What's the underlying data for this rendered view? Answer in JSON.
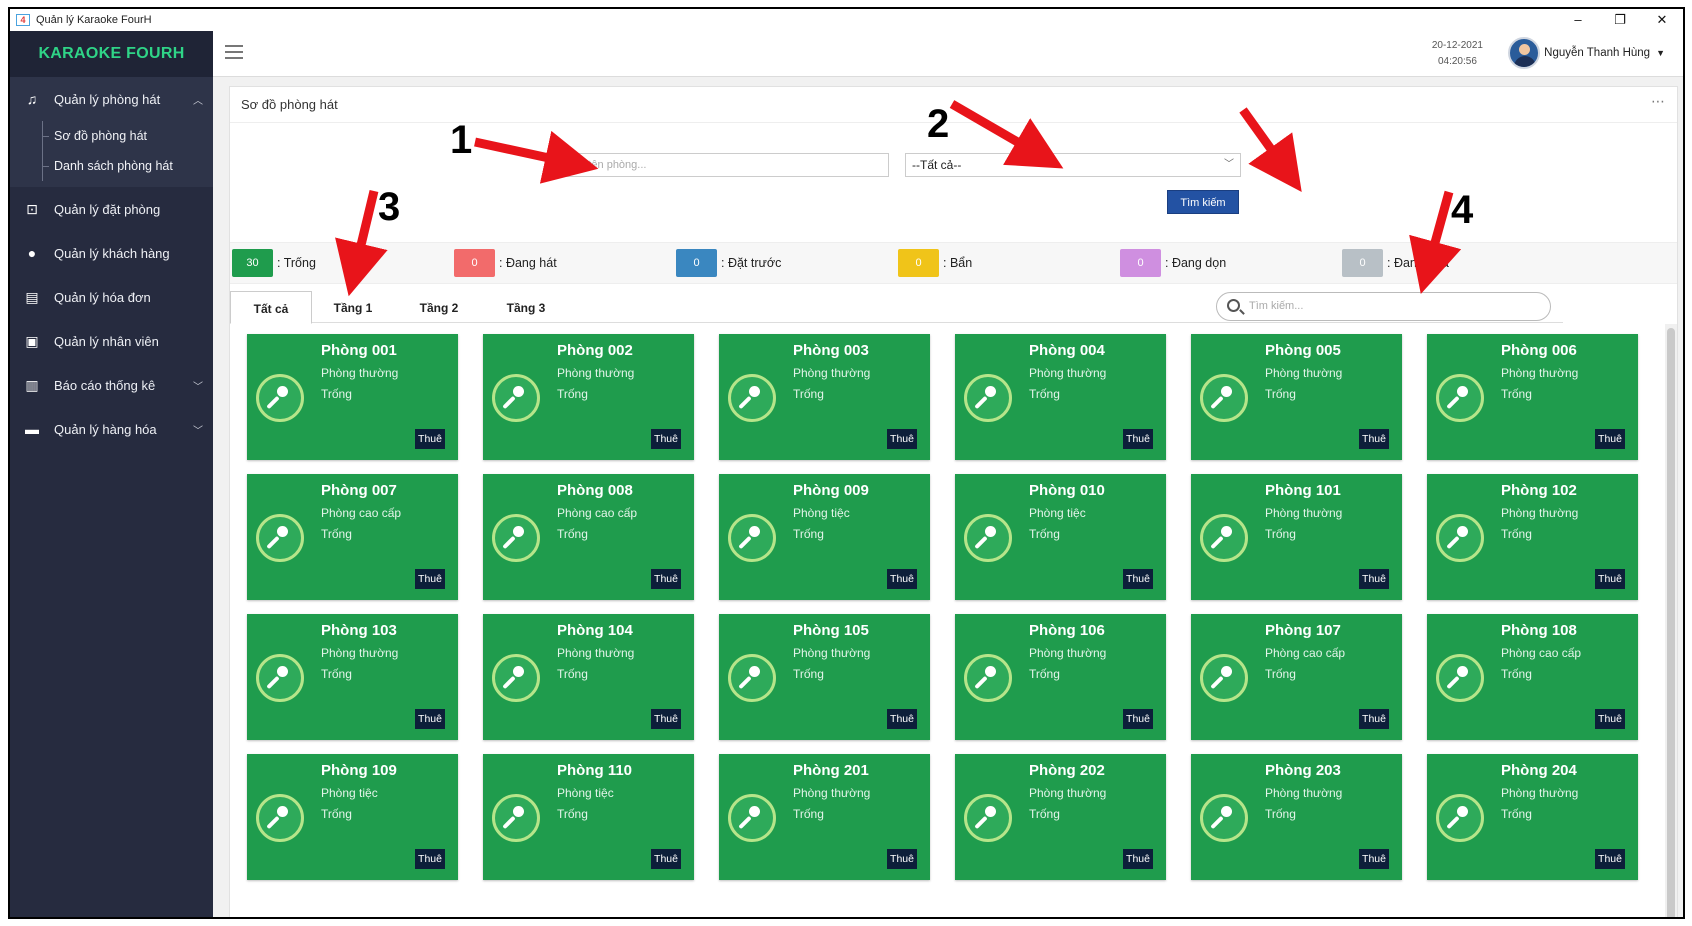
{
  "window": {
    "title": "Quản lý Karaoke FourH",
    "icon_label": "4"
  },
  "sidebar": {
    "brand": "KARAOKE FOURH",
    "items": [
      {
        "label": "Quản lý phòng hát",
        "icon": "singer-icon",
        "expanded": true,
        "children": [
          {
            "label": "Sơ đồ phòng hát"
          },
          {
            "label": "Danh sách phòng hát"
          }
        ]
      },
      {
        "label": "Quản lý đặt phòng",
        "icon": "booking-icon"
      },
      {
        "label": "Quản lý khách hàng",
        "icon": "user-icon"
      },
      {
        "label": "Quản lý hóa đơn",
        "icon": "invoice-icon"
      },
      {
        "label": "Quản lý nhân viên",
        "icon": "badge-icon"
      },
      {
        "label": "Báo cáo thống kê",
        "icon": "chart-icon",
        "has_children": true
      },
      {
        "label": "Quản lý hàng hóa",
        "icon": "box-icon",
        "has_children": true
      }
    ]
  },
  "header": {
    "date": "20-12-2021",
    "time": "04:20:56",
    "user_name": "Nguyễn Thanh Hùng"
  },
  "panel": {
    "title": "Sơ đồ phòng hát",
    "search_placeholder": "Nhập tên phòng...",
    "select_value": "--Tất cả--",
    "search_button": "Tìm kiếm"
  },
  "legend": [
    {
      "count": "30",
      "label": ": Trống",
      "color": "#1f9c4d"
    },
    {
      "count": "0",
      "label": ": Đang hát",
      "color": "#f26b6b"
    },
    {
      "count": "0",
      "label": ": Đặt trước",
      "color": "#3a87c0"
    },
    {
      "count": "0",
      "label": ": Bẩn",
      "color": "#f0c419"
    },
    {
      "count": "0",
      "label": ": Đang dọn",
      "color": "#cf8fe0"
    },
    {
      "count": "0",
      "label": ": Đang sửa",
      "color": "#b8c0c6"
    }
  ],
  "tabs": [
    {
      "label": "Tất cả",
      "active": true
    },
    {
      "label": "Tầng 1"
    },
    {
      "label": "Tầng 2"
    },
    {
      "label": "Tầng 3"
    }
  ],
  "room_search_placeholder": "Tìm kiếm...",
  "rent_label": "Thuê",
  "rooms": [
    {
      "name": "Phòng 001",
      "type": "Phòng thường",
      "status": "Trống"
    },
    {
      "name": "Phòng 002",
      "type": "Phòng thường",
      "status": "Trống"
    },
    {
      "name": "Phòng 003",
      "type": "Phòng thường",
      "status": "Trống"
    },
    {
      "name": "Phòng 004",
      "type": "Phòng thường",
      "status": "Trống"
    },
    {
      "name": "Phòng 005",
      "type": "Phòng thường",
      "status": "Trống"
    },
    {
      "name": "Phòng 006",
      "type": "Phòng thường",
      "status": "Trống"
    },
    {
      "name": "Phòng 007",
      "type": "Phòng cao cấp",
      "status": "Trống"
    },
    {
      "name": "Phòng 008",
      "type": "Phòng cao cấp",
      "status": "Trống"
    },
    {
      "name": "Phòng 009",
      "type": "Phòng tiệc",
      "status": "Trống"
    },
    {
      "name": "Phòng 010",
      "type": "Phòng tiệc",
      "status": "Trống"
    },
    {
      "name": "Phòng 101",
      "type": "Phòng thường",
      "status": "Trống"
    },
    {
      "name": "Phòng 102",
      "type": "Phòng thường",
      "status": "Trống"
    },
    {
      "name": "Phòng 103",
      "type": "Phòng thường",
      "status": "Trống"
    },
    {
      "name": "Phòng 104",
      "type": "Phòng thường",
      "status": "Trống"
    },
    {
      "name": "Phòng 105",
      "type": "Phòng thường",
      "status": "Trống"
    },
    {
      "name": "Phòng 106",
      "type": "Phòng thường",
      "status": "Trống"
    },
    {
      "name": "Phòng 107",
      "type": "Phòng cao cấp",
      "status": "Trống"
    },
    {
      "name": "Phòng 108",
      "type": "Phòng cao cấp",
      "status": "Trống"
    },
    {
      "name": "Phòng 109",
      "type": "Phòng tiệc",
      "status": "Trống"
    },
    {
      "name": "Phòng 110",
      "type": "Phòng tiệc",
      "status": "Trống"
    },
    {
      "name": "Phòng 201",
      "type": "Phòng thường",
      "status": "Trống"
    },
    {
      "name": "Phòng 202",
      "type": "Phòng thường",
      "status": "Trống"
    },
    {
      "name": "Phòng 203",
      "type": "Phòng thường",
      "status": "Trống"
    },
    {
      "name": "Phòng 204",
      "type": "Phòng thường",
      "status": "Trống"
    }
  ],
  "annotations": [
    {
      "label": "1"
    },
    {
      "label": "2"
    },
    {
      "label": "3"
    },
    {
      "label": "4"
    }
  ],
  "colors": {
    "sidebar_bg": "#262b3f",
    "brand_text": "#2fd487",
    "room_card": "#1f9c4d",
    "button": "#2352a3",
    "arrow": "#e8141a"
  }
}
